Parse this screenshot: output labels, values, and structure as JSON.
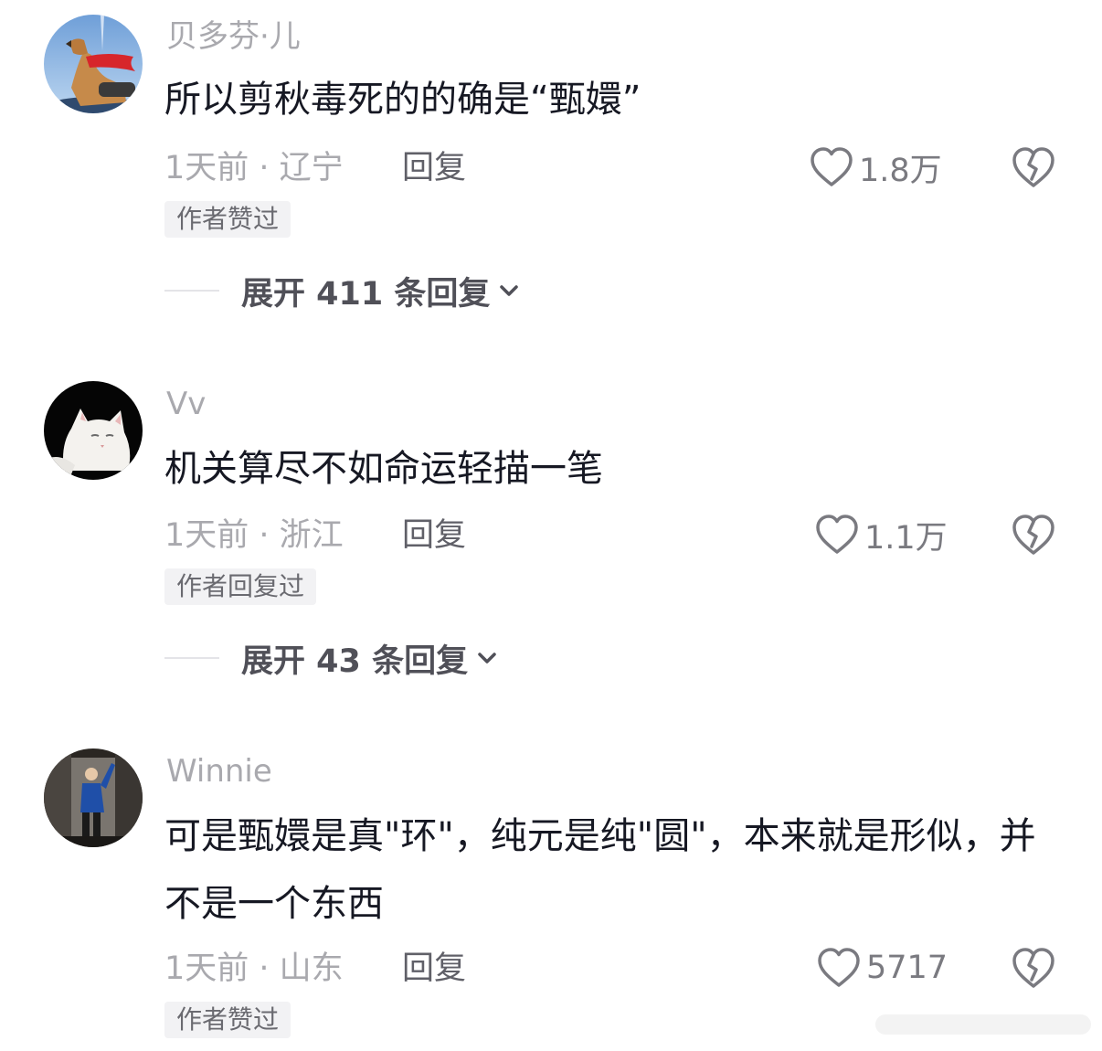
{
  "comments": [
    {
      "username": "贝多芬·儿",
      "content": "所以剪秋毒死的的确是“甄嬛”",
      "time_location": "1天前 · 辽宁",
      "reply_label": "回复",
      "likes": "1.8万",
      "badge": "作者赞过",
      "expand_text": "展开 411 条回复",
      "avatar_icon": "dog-with-red-cape-avatar"
    },
    {
      "username": "Vv",
      "content": "机关算尽不如命运轻描一笔",
      "time_location": "1天前 · 浙江",
      "reply_label": "回复",
      "likes": "1.1万",
      "badge": "作者回复过",
      "expand_text": "展开 43 条回复",
      "avatar_icon": "white-cat-avatar"
    },
    {
      "username": "Winnie",
      "content": "可是甄嬛是真\"环\"，纯元是纯\"圆\"，本来就是形似，并不是一个东西",
      "time_location": "1天前 · 山东",
      "reply_label": "回复",
      "likes": "5717",
      "badge": "作者赞过",
      "avatar_icon": "person-in-blue-avatar"
    }
  ],
  "icons": {
    "like": "heart-outline-icon",
    "dislike": "broken-heart-icon",
    "expand": "chevron-down-icon"
  },
  "colors": {
    "text_primary": "#161823",
    "text_secondary": "#a9a9ae",
    "badge_bg": "#f2f2f4",
    "expand_text": "#505058"
  }
}
